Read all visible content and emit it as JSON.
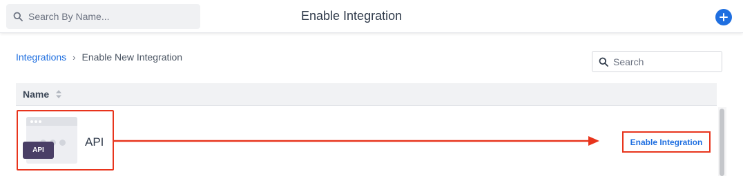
{
  "header": {
    "search_placeholder": "Search By Name...",
    "title": "Enable Integration"
  },
  "breadcrumb": {
    "parent": "Integrations",
    "separator": "›",
    "current": "Enable New Integration"
  },
  "table": {
    "search_placeholder": "Search",
    "column_name": "Name",
    "rows": [
      {
        "badge": "API",
        "name": "API",
        "action": "Enable Integration"
      }
    ]
  },
  "colors": {
    "accent": "#1f6fe0",
    "annotation": "#e8341c",
    "badge_bg": "#4a3f66"
  },
  "icons": {
    "search": "search-icon",
    "add": "plus-icon",
    "sort": "sort-icon"
  }
}
